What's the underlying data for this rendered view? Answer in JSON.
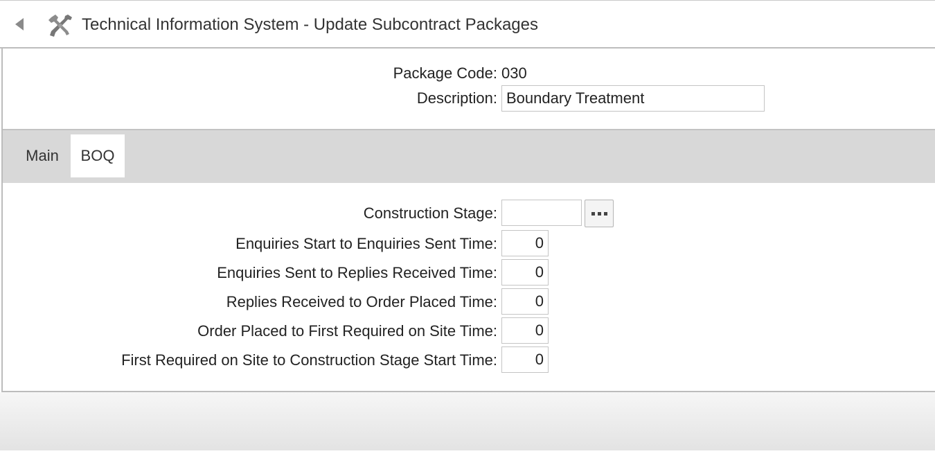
{
  "window": {
    "title": "Technical Information System - Update Subcontract Packages",
    "back_icon": "back-arrow-icon",
    "app_icon": "tools-icon"
  },
  "header": {
    "package_code_label": "Package Code:",
    "package_code_value": "030",
    "description_label": "Description:",
    "description_value": "Boundary Treatment"
  },
  "tabs": [
    {
      "label": "Main",
      "active": false
    },
    {
      "label": "BOQ",
      "active": true
    }
  ],
  "form": {
    "construction_stage": {
      "label": "Construction Stage:",
      "value": "",
      "lookup_icon": "ellipsis-icon"
    },
    "fields": [
      {
        "label": "Enquiries Start to Enquiries Sent Time:",
        "value": "0"
      },
      {
        "label": "Enquiries Sent to Replies Received Time:",
        "value": "0"
      },
      {
        "label": "Replies Received to Order Placed Time:",
        "value": "0"
      },
      {
        "label": "Order Placed to First Required on Site Time:",
        "value": "0"
      },
      {
        "label": "First Required on Site to Construction Stage Start Time:",
        "value": "0"
      }
    ]
  },
  "colors": {
    "tab_bar": "#d8d8d8",
    "active_tab": "#ffffff",
    "border": "#bcbcbc"
  }
}
